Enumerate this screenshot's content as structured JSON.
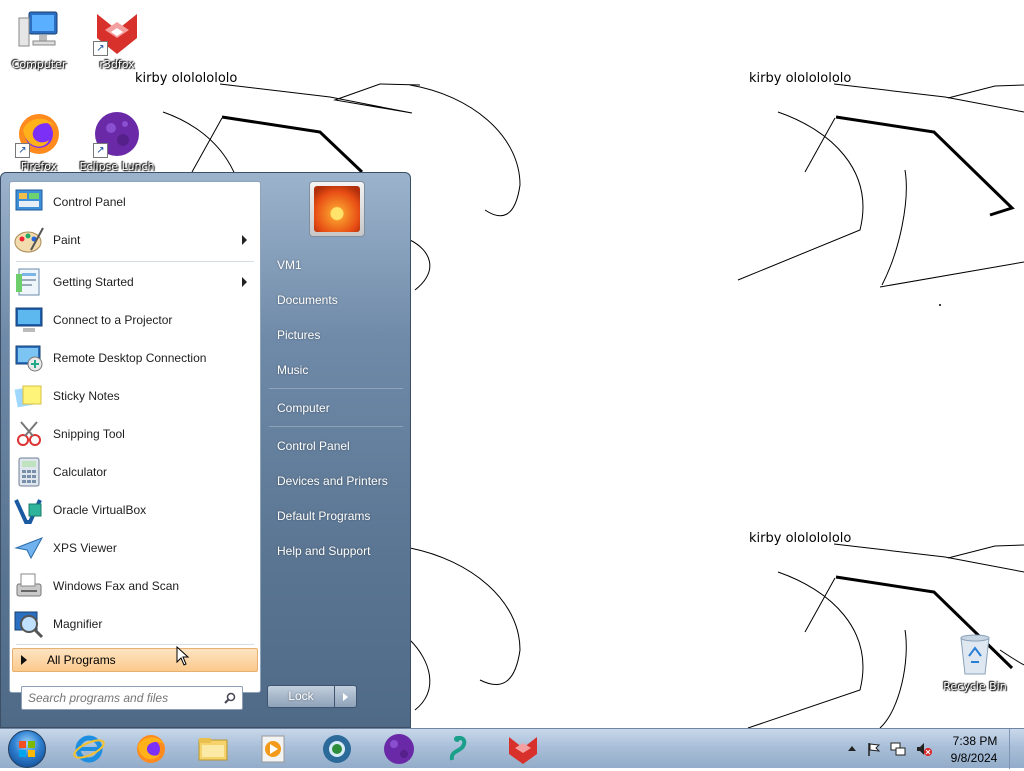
{
  "desktop": {
    "wallpaper_texts": [
      "kirby olololololo",
      "kirby olololololo",
      "kirby olololololo"
    ],
    "icons": [
      {
        "label": "Computer",
        "icon": "computer-icon",
        "shortcut": false
      },
      {
        "label": "r3dfox",
        "icon": "r3dfox-icon",
        "shortcut": true
      },
      {
        "label": "Firefox",
        "icon": "firefox-icon",
        "shortcut": true
      },
      {
        "label": "Eclipse Lunch",
        "icon": "eclipse-icon",
        "shortcut": true
      },
      {
        "label": "Recycle Bin",
        "icon": "recycle-bin-icon",
        "shortcut": false
      }
    ]
  },
  "start_menu": {
    "programs": [
      {
        "label": "Control Panel",
        "icon": "control-panel-icon",
        "submenu": false
      },
      {
        "label": "Paint",
        "icon": "paint-icon",
        "submenu": true
      },
      {
        "label": "Getting Started",
        "icon": "getting-started-icon",
        "submenu": true
      },
      {
        "label": "Connect to a Projector",
        "icon": "projector-icon",
        "submenu": false
      },
      {
        "label": "Remote Desktop Connection",
        "icon": "remote-desktop-icon",
        "submenu": false
      },
      {
        "label": "Sticky Notes",
        "icon": "sticky-notes-icon",
        "submenu": false
      },
      {
        "label": "Snipping Tool",
        "icon": "snipping-tool-icon",
        "submenu": false
      },
      {
        "label": "Calculator",
        "icon": "calculator-icon",
        "submenu": false
      },
      {
        "label": "Oracle VirtualBox",
        "icon": "virtualbox-icon",
        "submenu": false
      },
      {
        "label": "XPS Viewer",
        "icon": "xps-viewer-icon",
        "submenu": false
      },
      {
        "label": "Windows Fax and Scan",
        "icon": "fax-scan-icon",
        "submenu": false
      },
      {
        "label": "Magnifier",
        "icon": "magnifier-icon",
        "submenu": false
      }
    ],
    "all_programs_label": "All Programs",
    "search_placeholder": "Search programs and files",
    "right_items": [
      "VM1",
      "Documents",
      "Pictures",
      "Music",
      "Computer",
      "Control Panel",
      "Devices and Printers",
      "Default Programs",
      "Help and Support"
    ],
    "lock_label": "Lock"
  },
  "taskbar": {
    "apps": [
      "internet-explorer-icon",
      "firefox-icon",
      "file-explorer-icon",
      "media-player-icon",
      "chrome-like-icon",
      "eclipse-icon",
      "snake-icon",
      "r3dfox-icon"
    ],
    "tray_icons": [
      "show-hidden-icons",
      "action-center-flag-icon",
      "network-icon",
      "volume-muted-icon"
    ],
    "clock_time": "7:38 PM",
    "clock_date": "9/8/2024"
  }
}
